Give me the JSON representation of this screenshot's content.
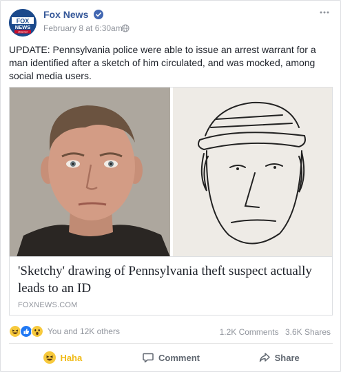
{
  "post": {
    "page_name": "Fox News",
    "timestamp": "February 8 at 6:30am",
    "timestamp_sep": "·",
    "text": "UPDATE: Pennsylvania police were able to issue an arrest warrant for a man identified after a sketch of him circulated, and was mocked, among social media users.",
    "avatar_logo": [
      "FOX",
      "NEWS",
      "channel"
    ]
  },
  "link": {
    "title": "'Sketchy' drawing of Pennsylvania theft suspect actually leads to an ID",
    "domain": "FOXNEWS.COM"
  },
  "engagement": {
    "reactions_text": "You and 12K others",
    "comments": "1.2K Comments",
    "shares": "3.6K Shares",
    "reaction_icons": [
      "haha-icon",
      "like-icon",
      "wow-icon"
    ]
  },
  "actions": {
    "haha": "Haha",
    "comment": "Comment",
    "share": "Share"
  },
  "colors": {
    "page_link": "#365899",
    "haha": "#f0ba15",
    "like": "#2078f4",
    "muted": "#90949c"
  }
}
